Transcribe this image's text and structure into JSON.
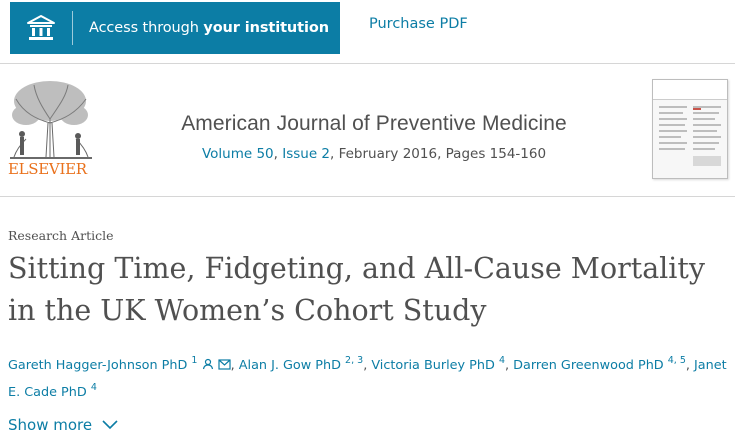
{
  "toolbar": {
    "access_prefix": "Access through ",
    "access_strong": "your institution",
    "purchase_label": "Purchase PDF"
  },
  "publisher": {
    "name": "ELSEVIER"
  },
  "journal": {
    "title": "American Journal of Preventive Medicine",
    "volume": "Volume 50",
    "issue": "Issue 2",
    "date_pages": ", February 2016, Pages 154-160"
  },
  "article": {
    "type": "Research Article",
    "title": "Sitting Time, Fidgeting, and All-Cause Mortality in the UK Women’s Cohort Study",
    "authors": [
      {
        "name": "Gareth Hagger-Johnson PhD",
        "sup": "1",
        "icons": [
          "person-icon",
          "email-icon"
        ]
      },
      {
        "name": "Alan J. Gow PhD",
        "sup": "2, 3"
      },
      {
        "name": "Victoria Burley PhD",
        "sup": "4"
      },
      {
        "name": "Darren Greenwood PhD",
        "sup": "4, 5"
      },
      {
        "name": "Janet E. Cade PhD",
        "sup": "4"
      }
    ],
    "show_more_label": "Show more"
  },
  "colors": {
    "accent": "#0c7da5",
    "publisher": "#e9711c",
    "text": "#505050"
  }
}
